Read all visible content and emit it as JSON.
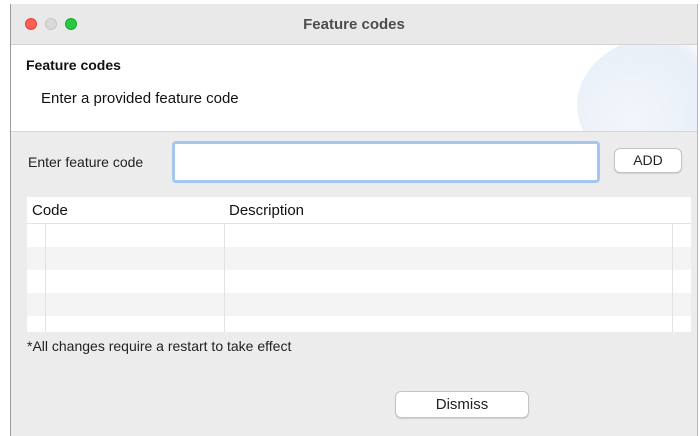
{
  "window": {
    "title": "Feature codes"
  },
  "header": {
    "title": "Feature codes",
    "subtitle": "Enter a provided feature code"
  },
  "form": {
    "code_label": "Enter feature code",
    "code_value": "",
    "add_label": "ADD"
  },
  "table": {
    "columns": [
      "Code",
      "Description"
    ],
    "rows": []
  },
  "footer": {
    "note": "*All changes require a restart to take effect",
    "dismiss_label": "Dismiss"
  },
  "colors": {
    "close": "#fe5f57",
    "minimize": "#d9d9d9",
    "maximize": "#28c840",
    "input_focus_border": "#a6c6ee"
  }
}
